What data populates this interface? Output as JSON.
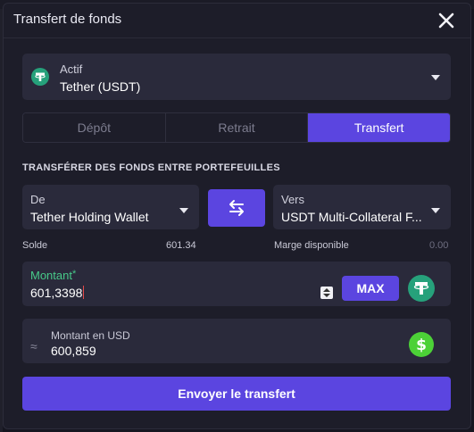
{
  "modal": {
    "title": "Transfert de fonds"
  },
  "asset": {
    "label": "Actif",
    "value": "Tether (USDT)",
    "icon": "tether-icon",
    "icon_color": "#26a17b"
  },
  "tabs": [
    {
      "label": "Dépôt",
      "active": false
    },
    {
      "label": "Retrait",
      "active": false
    },
    {
      "label": "Transfert",
      "active": true
    }
  ],
  "section_title": "TRANSFÉRER DES FONDS ENTRE PORTEFEUILLES",
  "from": {
    "label": "De",
    "value": "Tether Holding Wallet",
    "balance_label": "Solde",
    "balance_value": "601.34"
  },
  "to": {
    "label": "Vers",
    "value": "USDT Multi-Collateral F...",
    "margin_label": "Marge disponible",
    "margin_value": "0.00"
  },
  "amount": {
    "label": "Montant",
    "required_mark": "*",
    "value": "601,3398",
    "max_label": "MAX"
  },
  "usd": {
    "approx_symbol": "≈",
    "label": "Montant en USD",
    "value": "600,859",
    "icon_color": "#4cd137"
  },
  "submit_label": "Envoyer le transfert",
  "colors": {
    "accent": "#5b45e0",
    "success": "#47c989",
    "background": "#1d1d29",
    "field": "#2a2a3b"
  }
}
